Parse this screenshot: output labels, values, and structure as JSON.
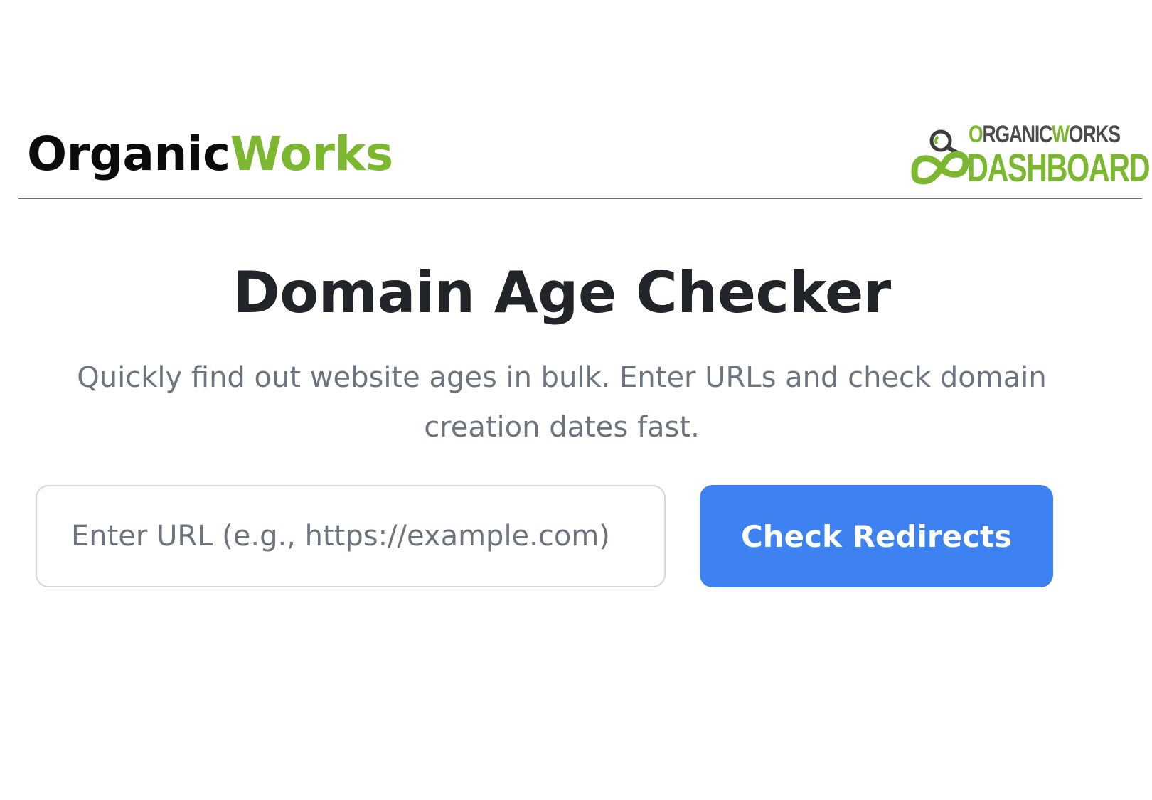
{
  "header": {
    "brand_part_a": "Organic",
    "brand_part_b": "Works",
    "brand_colors": {
      "dark": "#0b0b0b",
      "green": "#7cb82f"
    },
    "dashboard_logo": {
      "line1_green": "O",
      "line1_dark_a": "RGANIC",
      "line1_green_b": "W",
      "line1_dark_b": "ORKS",
      "line2": "DASHBOARD",
      "icons": [
        "magnifier-icon",
        "infinity-icon"
      ]
    }
  },
  "main": {
    "title": "Domain Age Checker",
    "subtitle": "Quickly find out website ages in bulk. Enter URLs and check domain creation dates fast.",
    "url_input": {
      "value": "",
      "placeholder": "Enter URL (e.g., https://example.com)"
    },
    "check_button_label": "Check Redirects",
    "accent_color": "#3d82f0"
  }
}
